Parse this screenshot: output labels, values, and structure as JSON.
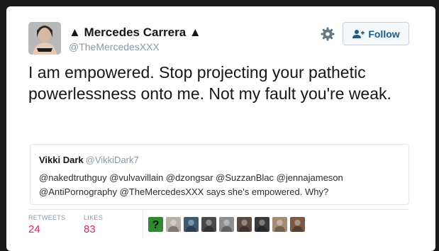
{
  "author": {
    "display_name": "▲ Mercedes Carrera ▲",
    "handle": "@TheMercedesXXX",
    "avatar_icon": "profile-photo"
  },
  "actions": {
    "settings_icon": "gear-icon",
    "follow_label": "Follow",
    "follow_icon": "add-user-icon"
  },
  "tweet": {
    "text": "I am empowered. Stop projecting your pathetic powerlessness onto me. Not my fault you're weak."
  },
  "quoted_tweet": {
    "author_name": "Vikki Dark",
    "author_handle": "@VikkiDark7",
    "text": "@nakedtruthguy @vulvavillain @dzongsar @SuzzanBlac @jennajameson @AntiPornography @TheMercedesXXX says she's empowered. Why?"
  },
  "stats": {
    "retweets_label": "RETWEETS",
    "retweets_value": "24",
    "likes_label": "LIKES",
    "likes_value": "83"
  },
  "liker_avatars": [
    {
      "icon": "question-mark-avatar",
      "color": "#2e8b2e"
    },
    {
      "icon": "avatar-photo",
      "color": "#b7b0a6"
    },
    {
      "icon": "avatar-photo",
      "color": "#3d5a73"
    },
    {
      "icon": "avatar-photo",
      "color": "#4a4a4a"
    },
    {
      "icon": "avatar-photo",
      "color": "#8f8f8f"
    },
    {
      "icon": "avatar-photo",
      "color": "#5b4a40"
    },
    {
      "icon": "avatar-photo",
      "color": "#3a3a3a"
    },
    {
      "icon": "avatar-photo",
      "color": "#a48c74"
    },
    {
      "icon": "avatar-photo",
      "color": "#7a5a45"
    }
  ],
  "colors": {
    "likes_accent": "#e0245e",
    "follow_text": "#1d5b8a",
    "muted": "#8899a6"
  }
}
